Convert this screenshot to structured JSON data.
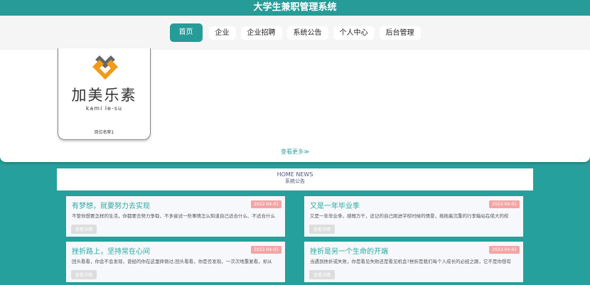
{
  "header": {
    "title": "大学生兼职管理系统"
  },
  "nav": [
    {
      "label": "首页"
    },
    {
      "label": "企业"
    },
    {
      "label": "企业招聘"
    },
    {
      "label": "系统公告"
    },
    {
      "label": "个人中心"
    },
    {
      "label": "后台管理"
    }
  ],
  "jobs": {
    "items": [
      {
        "brand": "加美乐素",
        "brand_en": "kami le-su",
        "name": "岗位名称1"
      }
    ],
    "more": "查看更多≫"
  },
  "notice": {
    "en": "HOME NEWS",
    "cn": "系统公告"
  },
  "news": [
    {
      "title": "有梦想，就要努力去实现",
      "date": "2022-04-01",
      "content": "不管你想要怎样的生活，你都要去努力争取，不多尝试一些事情怎么知道自己适合什么、不适合什么",
      "button": "查看详情"
    },
    {
      "title": "又是一年毕业季",
      "date": "2022-04-01",
      "content": "又是一年毕业季，感慨万千，还记的自己刚进学校时候的情景，拖拖着沉重的行李箱站在偌大的校",
      "button": "查看详情"
    },
    {
      "title": "挫折路上，坚持常在心间",
      "date": "2022-04-01",
      "content": "回头看看，你会不会发现，曾经的你在这里摔倒过;回头看看，你是否发现，一次次地重复看，却从",
      "button": "查看详情"
    },
    {
      "title": "挫折是另一个生命的开端",
      "date": "2022-04-01",
      "content": "当遇到挫折或失败，你是看见失败还是看见机会?挫折是我们每个人成长的必经之路，它不是你想有",
      "button": "查看详情"
    }
  ]
}
